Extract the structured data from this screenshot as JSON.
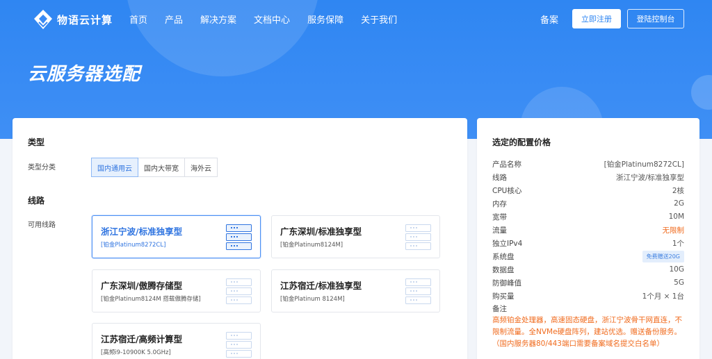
{
  "brand": {
    "name": "物语云计算"
  },
  "nav": {
    "links": [
      "首页",
      "产品",
      "解决方案",
      "文档中心",
      "服务保障",
      "关于我们"
    ],
    "beian": "备案",
    "register": "立即注册",
    "console": "登陆控制台"
  },
  "page": {
    "title": "云服务器选配"
  },
  "type_section": {
    "heading": "类型",
    "label": "类型分类",
    "tabs": [
      "国内通用云",
      "国内大带宽",
      "海外云"
    ],
    "active_tab": "国内通用云"
  },
  "line_section": {
    "heading": "线路",
    "label": "可用线路",
    "cards": [
      {
        "title": "浙江宁波/标准独享型",
        "sub": "[铂金Platinum8272CL]",
        "selected": true
      },
      {
        "title": "广东深圳/标准独享型",
        "sub": "[铂金Platinum8124M]",
        "selected": false
      },
      {
        "title": "广东深圳/傲腾存储型",
        "sub": "[铂金Platinum8124M 搭载傲腾存储]",
        "selected": false
      },
      {
        "title": "江苏宿迁/标准独享型",
        "sub": "[铂金Platinum 8124M]",
        "selected": false
      },
      {
        "title": "江苏宿迁/高频计算型",
        "sub": "[高频i9-10900K 5.0GHz]",
        "selected": false
      }
    ]
  },
  "summary": {
    "title": "选定的配置价格",
    "rows": [
      {
        "k": "产品名称",
        "v": "[铂金Platinum8272CL]"
      },
      {
        "k": "线路",
        "v": "浙江宁波/标准独享型"
      },
      {
        "k": "CPU核心",
        "v": "2核"
      },
      {
        "k": "内存",
        "v": "2G"
      },
      {
        "k": "宽带",
        "v": "10M"
      },
      {
        "k": "流量",
        "v": "无限制"
      },
      {
        "k": "独立IPv4",
        "v": "1个"
      },
      {
        "k": "系统盘",
        "v": "免费赠送20G"
      },
      {
        "k": "数据盘",
        "v": "10G"
      },
      {
        "k": "防御峰值",
        "v": "5G"
      },
      {
        "k": "购买量",
        "v": "1个月 × 1台"
      }
    ],
    "note_label": "备注",
    "note": "高频铂金处理器，高速固态硬盘，浙江宁波骨干网直连，不限制流量。全NVMe硬盘阵列，建站优选。赠送备份服务。（国内服务器80/443端口需要备案域名提交白名单）"
  },
  "colors": {
    "primary": "#2f86f2",
    "accent_orange": "#f06a1c"
  }
}
